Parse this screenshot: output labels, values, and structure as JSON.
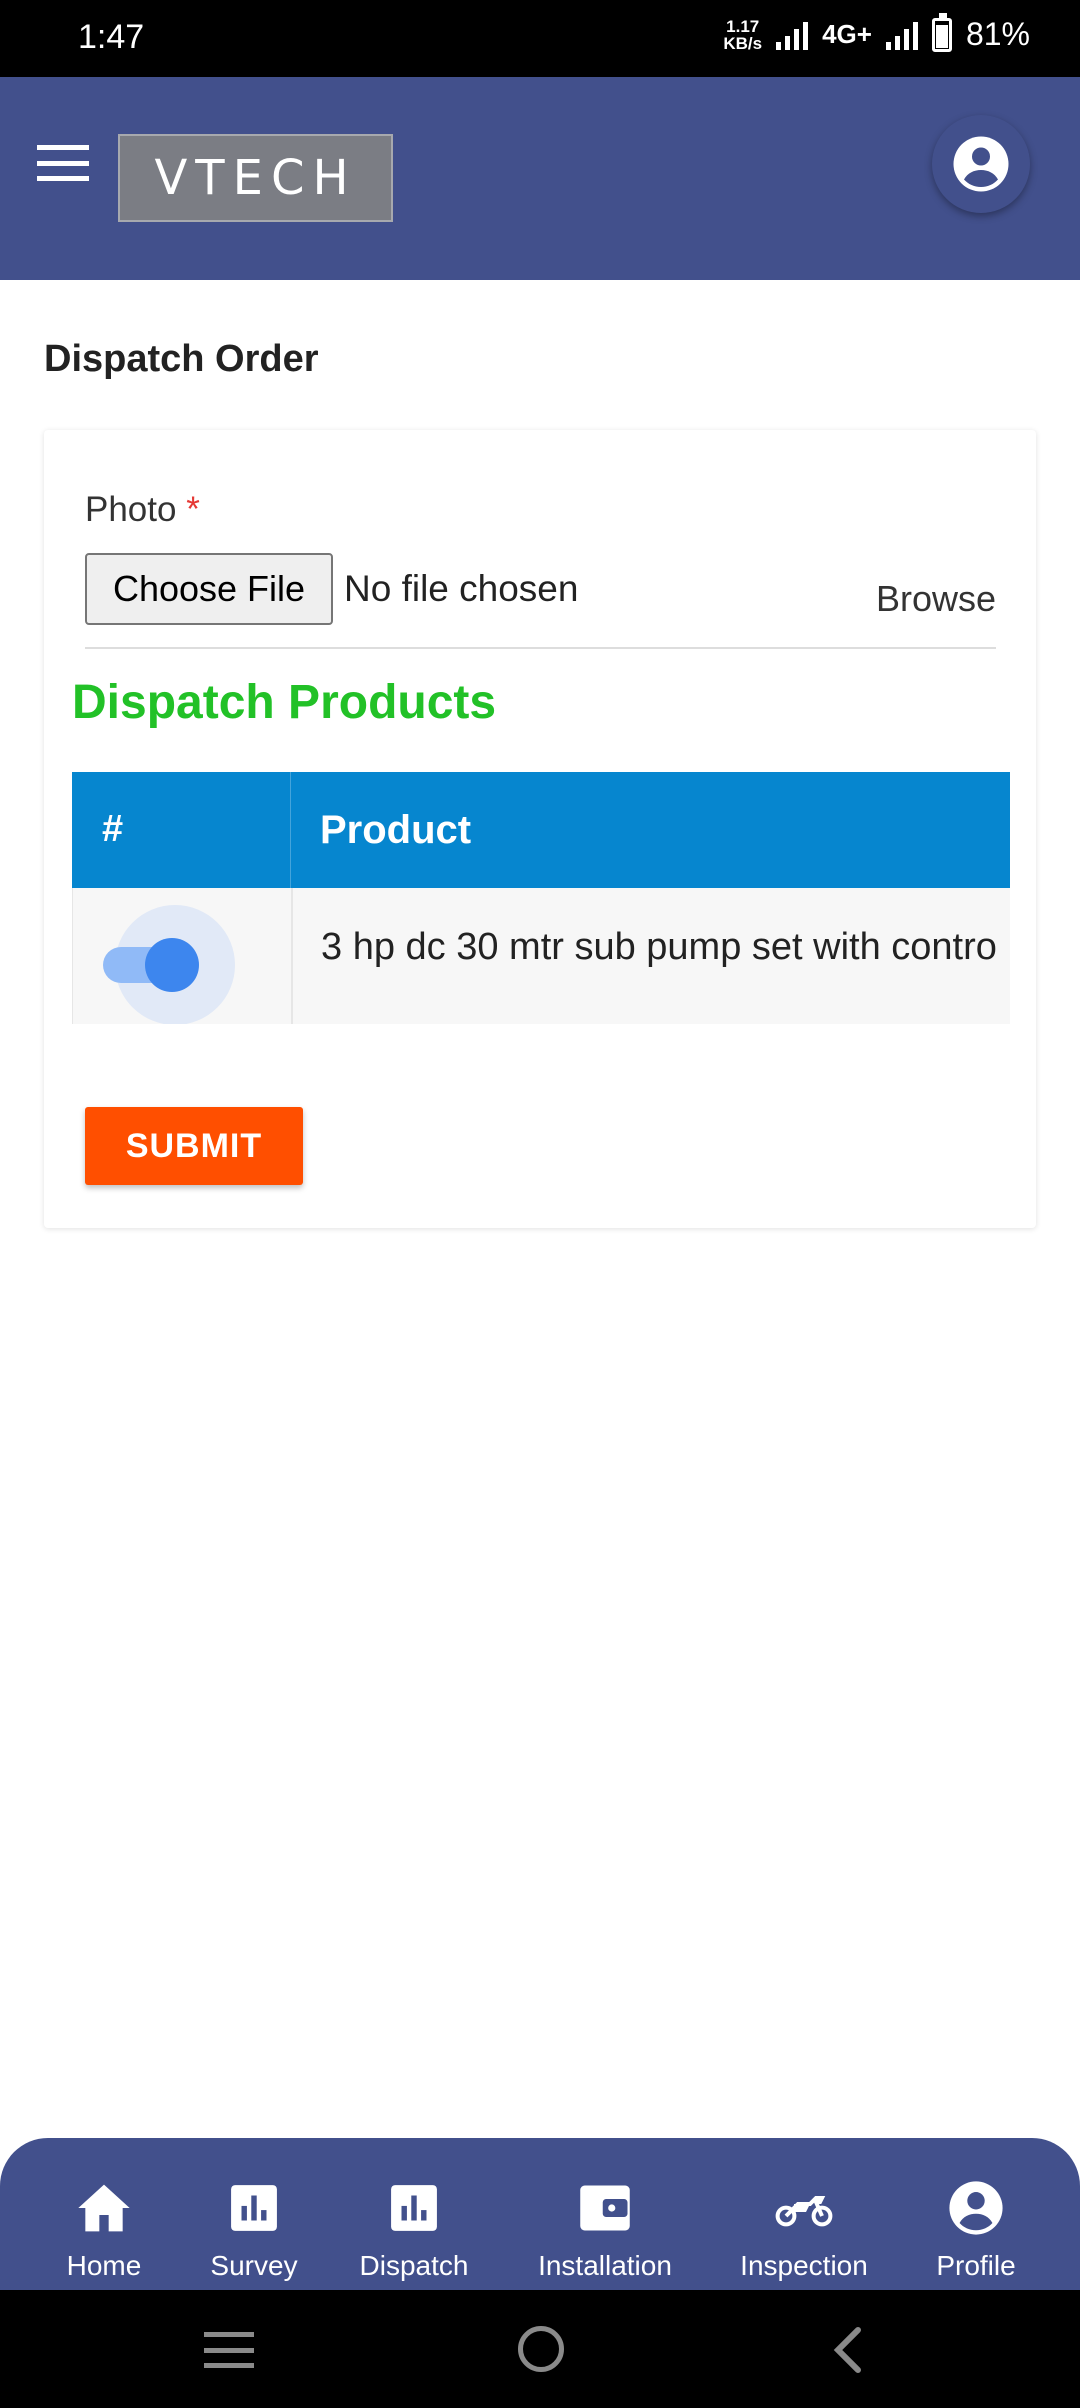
{
  "status_bar": {
    "time": "1:47",
    "net_speed_value": "1.17",
    "net_speed_unit": "KB/s",
    "network_type": "4G+",
    "battery_percent": "81%",
    "battery_level": 0.81
  },
  "header": {
    "logo_text": "VTECH",
    "menu_icon": "hamburger-menu-icon",
    "profile_icon": "account-circle-icon",
    "background_color": "#42508c"
  },
  "page": {
    "title": "Dispatch Order"
  },
  "form": {
    "photo_label": "Photo",
    "required_marker": "*",
    "choose_file_label": "Choose File",
    "no_file_text": "No file chosen",
    "browse_label": "Browse",
    "section_title": "Dispatch Products",
    "table": {
      "columns": [
        "#",
        "Product"
      ],
      "rows": [
        {
          "selected": true,
          "product": "3 hp dc 30 mtr sub pump set with contro"
        }
      ]
    },
    "submit_label": "SUBMIT"
  },
  "bottom_nav": {
    "items": [
      {
        "label": "Home",
        "icon": "home-icon"
      },
      {
        "label": "Survey",
        "icon": "bar-chart-icon"
      },
      {
        "label": "Dispatch",
        "icon": "bar-chart-icon"
      },
      {
        "label": "Installation",
        "icon": "wallet-icon"
      },
      {
        "label": "Inspection",
        "icon": "motorcycle-icon"
      },
      {
        "label": "Profile",
        "icon": "account-circle-icon"
      }
    ]
  },
  "colors": {
    "primary": "#42508c",
    "table_header": "#0686cf",
    "section_title": "#22c127",
    "submit": "#ff4f00",
    "toggle": "#3d86ee"
  }
}
